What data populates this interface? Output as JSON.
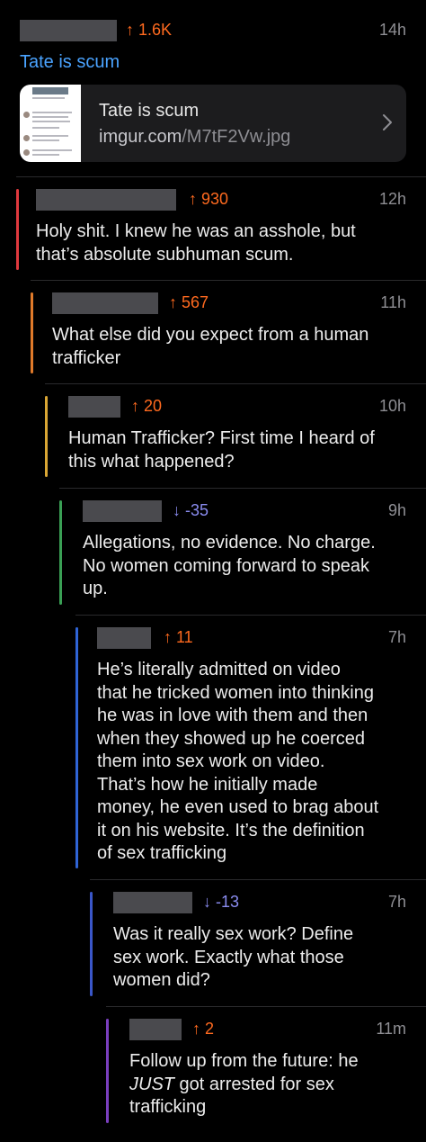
{
  "post": {
    "score": "↑ 1.6K",
    "time": "14h",
    "title": "Tate is scum",
    "link": {
      "title": "Tate is scum",
      "domain": "imgur.com",
      "path": "/M7tF2Vw.jpg"
    }
  },
  "comments": [
    {
      "score": "↑ 930",
      "vote": "up",
      "time": "12h",
      "color": "#e0393e",
      "body": [
        "Holy shit. I knew he was an asshole, but",
        "that’s absolute subhuman scum."
      ]
    },
    {
      "score": "↑ 567",
      "vote": "up",
      "time": "11h",
      "color": "#e07a2a",
      "body": [
        "What else did you expect from a human",
        "trafficker"
      ]
    },
    {
      "score": "↑ 20",
      "vote": "up",
      "time": "10h",
      "color": "#d9a634",
      "body": [
        "Human Trafficker? First time I heard of",
        "this what happened?"
      ]
    },
    {
      "score": "↓ -35",
      "vote": "down",
      "time": "9h",
      "color": "#3aa055",
      "body": [
        "Allegations, no evidence. No charge.",
        "No women coming forward to speak",
        "up."
      ]
    },
    {
      "score": "↑ 11",
      "vote": "up",
      "time": "7h",
      "color": "#2f64d6",
      "body": [
        "He’s literally admitted on video",
        "that he tricked women into thinking",
        "he was in love with them and then",
        "when they showed up he coerced",
        "them into sex work on video.",
        "That’s how he initially made",
        "money, he even used to brag about",
        "it on his website. It’s the definition",
        "of sex trafficking"
      ]
    },
    {
      "score": "↓ -13",
      "vote": "down",
      "time": "7h",
      "color": "#3a56c8",
      "body": [
        "Was it really sex work? Define",
        "sex work.  Exactly what those",
        "women did?"
      ]
    },
    {
      "score": "↑ 2",
      "vote": "up",
      "time": "11m",
      "color": "#7a3fbf",
      "body_last": {
        "l1": "Follow up from the future: he",
        "l2_em": "JUST",
        "l2_rest": " got arrested for sex",
        "l3": "trafficking"
      }
    }
  ]
}
